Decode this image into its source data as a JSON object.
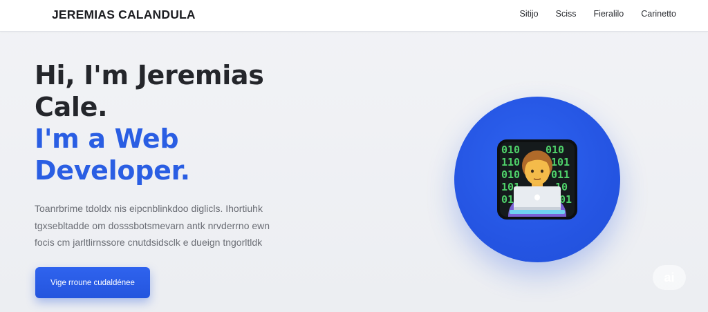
{
  "header": {
    "brand": "JEREMIAS CALANDULA",
    "nav": [
      "Sitijo",
      "Sciss",
      "Fieralilo",
      "Carinetto"
    ]
  },
  "hero": {
    "title_line1": "Hi, I'm Jeremias",
    "title_line2": "Cale.",
    "accent_line1": "I'm a Web",
    "accent_line2": "Developer.",
    "description_lines": [
      "Toanrbrime tdoldx nis eipcnblinkdoo diglicls. Ihortiuhk",
      "tgxsebltadde om dosssbotsmevarn antk nrvderrno ewn",
      "focis cm jarltlirnssore cnutdsidsclk e dueign tngorltldk"
    ],
    "cta_label": "Vige rroune cudaldénee"
  },
  "badge": {
    "label": "ai"
  },
  "colors": {
    "accent": "#2a5ee3",
    "button": "#2455de",
    "text_dark": "#24262b",
    "text_muted": "#6b6e75"
  },
  "icons": [
    "developer-avatar-icon"
  ]
}
